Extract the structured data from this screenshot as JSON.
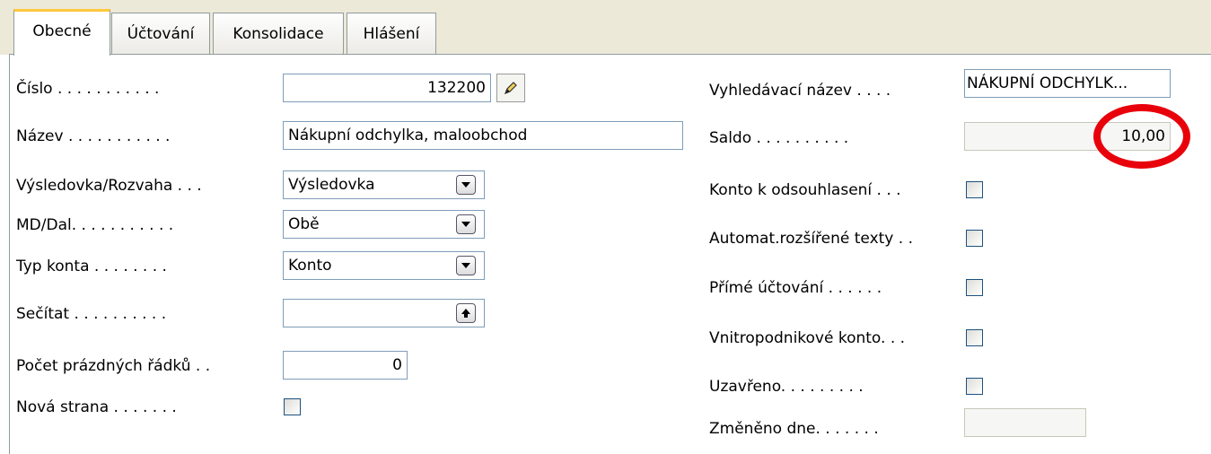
{
  "tabs": [
    {
      "label": "Obecné",
      "active": true
    },
    {
      "label": "Účtování",
      "active": false
    },
    {
      "label": "Konsolidace",
      "active": false
    },
    {
      "label": "Hlášení",
      "active": false
    }
  ],
  "left": {
    "cislo": {
      "label": "Číslo . . . . . . . . . . .",
      "value": "132200"
    },
    "nazev": {
      "label": "Název . . . . . . . . . . .",
      "value": "Nákupní odchylka, maloobchod"
    },
    "vysledovka": {
      "label": "Výsledovka/Rozvaha . . .",
      "value": "Výsledovka"
    },
    "mddal": {
      "label": "MD/Dal. . . . . . . . . . .",
      "value": "Obě"
    },
    "typ_konta": {
      "label": "Typ konta . . . . . . . .",
      "value": "Konto"
    },
    "secitat": {
      "label": "Sečítat . . . . . . . . . .",
      "value": ""
    },
    "pocet_radku": {
      "label": "Počet prázdných řádků . .",
      "value": "0"
    },
    "nova_strana": {
      "label": "Nová strana . . . . . . .",
      "checked": false
    }
  },
  "right": {
    "vyhledavaci": {
      "label": "Vyhledávací název . . . .",
      "value": "NÁKUPNÍ ODCHYLK..."
    },
    "saldo": {
      "label": "Saldo . . . . . . . . . .",
      "value": "10,00"
    },
    "konto_odsouhlaseni": {
      "label": "Konto k odsouhlasení . . .",
      "checked": false
    },
    "automat_texty": {
      "label": "Automat.rozšířené texty . .",
      "checked": false
    },
    "prime_uctovani": {
      "label": "Přímé účtování . . . . . .",
      "checked": false
    },
    "vnitropodnikove": {
      "label": "Vnitropodnikové konto. . .",
      "checked": false
    },
    "uzavreno": {
      "label": "Uzavřeno. . . . . . . . .",
      "checked": false
    },
    "zmeneno": {
      "label": "Změněno dne. . . . . . .",
      "value": ""
    }
  },
  "highlight_color": "#e8000b"
}
